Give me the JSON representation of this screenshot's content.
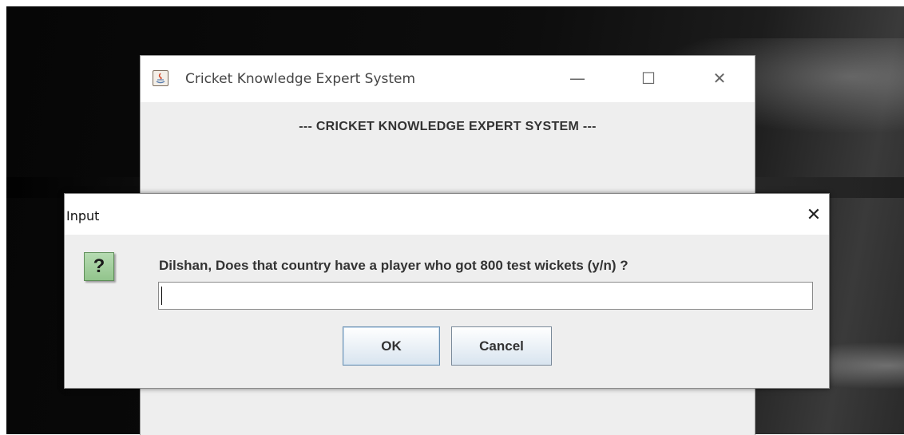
{
  "main_window": {
    "title": "Cricket Knowledge Expert System",
    "heading": "--- CRICKET KNOWLEDGE EXPERT SYSTEM ---",
    "controls": {
      "minimize": "—",
      "maximize": "☐",
      "close": "✕"
    }
  },
  "dialog": {
    "title": "Input",
    "close": "✕",
    "icon": {
      "name": "question-icon",
      "glyph": "?"
    },
    "prompt": "Dilshan, Does that country have a player who got 800 test wickets (y/n) ?",
    "input": {
      "value": ""
    },
    "buttons": {
      "ok": "OK",
      "cancel": "Cancel"
    }
  },
  "colors": {
    "dialog_bg": "#eeeeee",
    "titlebar_bg": "#ffffff",
    "question_icon": "#a3cf9e",
    "button_focus_border": "#6a8fb0"
  }
}
